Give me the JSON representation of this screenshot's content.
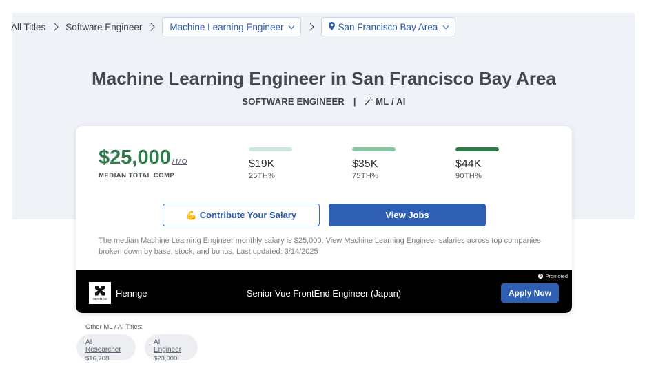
{
  "breadcrumb": {
    "all_titles": "All Titles",
    "parent": "Software Engineer",
    "title_select": "Machine Learning Engineer",
    "location_select": "San Francisco Bay Area"
  },
  "header": {
    "title": "Machine Learning Engineer in San Francisco Bay Area",
    "family": "SOFTWARE ENGINEER",
    "separator": "|",
    "specialization": "ML / AI"
  },
  "compensation": {
    "median": "$25,000",
    "period": "/ MO",
    "median_label": "MEDIAN TOTAL COMP",
    "percentiles": [
      {
        "value": "$19K",
        "label": "25TH%",
        "color": "#cfe6da"
      },
      {
        "value": "$35K",
        "label": "75TH%",
        "color": "#86c7a2"
      },
      {
        "value": "$44K",
        "label": "90TH%",
        "color": "#2f7a47"
      }
    ]
  },
  "actions": {
    "contribute": "💪 Contribute Your Salary",
    "view_jobs": "View Jobs"
  },
  "description": "The median Machine Learning Engineer monthly salary is $25,000. View Machine Learning Engineer salaries across top companies broken down by base, stock, and bonus. Last updated: 3/14/2025",
  "promo": {
    "company": "Hennge",
    "logo_text": "HENNGE",
    "job_title": "Senior Vue FrontEnd Engineer (Japan)",
    "promoted": "Promoted",
    "apply": "Apply Now"
  },
  "other_titles": {
    "label": "Other ML / AI Titles:",
    "items": [
      {
        "name": "AI Researcher",
        "value": "$16,708"
      },
      {
        "name": "AI Engineer",
        "value": "$23,000"
      }
    ]
  },
  "colors": {
    "accent_blue": "#2f5fb3",
    "median_green": "#2f7c4a"
  }
}
